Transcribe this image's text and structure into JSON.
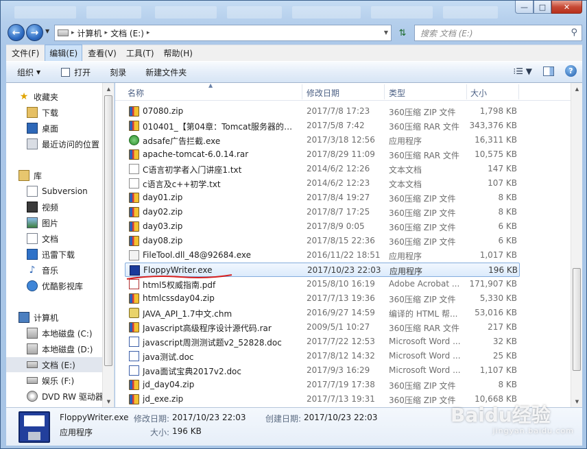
{
  "window": {
    "controls": {
      "minimize": "—",
      "maximize": "□",
      "close": "✕"
    }
  },
  "address": {
    "segments": [
      "计算机",
      "文档 (E:)"
    ],
    "search_placeholder": "搜索 文档 (E:)"
  },
  "menu": [
    "文件(F)",
    "编辑(E)",
    "查看(V)",
    "工具(T)",
    "帮助(H)"
  ],
  "toolbar": {
    "organize": "组织",
    "open": "打开",
    "burn": "刻录",
    "new_folder": "新建文件夹"
  },
  "navpane": {
    "favorites": {
      "title": "收藏夹",
      "items": [
        "下载",
        "桌面",
        "最近访问的位置"
      ]
    },
    "libraries": {
      "title": "库",
      "items": [
        "Subversion",
        "视频",
        "图片",
        "文档",
        "迅雷下载",
        "音乐",
        "优酷影视库"
      ]
    },
    "computer": {
      "title": "计算机",
      "items": [
        "本地磁盘 (C:)",
        "本地磁盘 (D:)",
        "文档 (E:)",
        "娱乐 (F:)",
        "DVD RW 驱动器"
      ]
    }
  },
  "columns": {
    "name": "名称",
    "date": "修改日期",
    "type": "类型",
    "size": "大小"
  },
  "files": [
    {
      "name": "07080.zip",
      "date": "2017/7/8 17:23",
      "type": "360压缩 ZIP 文件",
      "size": "1,798 KB",
      "icon": "zip"
    },
    {
      "name": "010401_【第04章：Tomcat服务器的安...",
      "date": "2017/5/8 7:42",
      "type": "360压缩 RAR 文件",
      "size": "343,376 KB",
      "icon": "zip"
    },
    {
      "name": "adsafe广告拦截.exe",
      "date": "2017/3/18 12:56",
      "type": "应用程序",
      "size": "16,311 KB",
      "icon": "green"
    },
    {
      "name": "apache-tomcat-6.0.14.rar",
      "date": "2017/8/29 11:09",
      "type": "360压缩 RAR 文件",
      "size": "10,575 KB",
      "icon": "zip"
    },
    {
      "name": "C语言初学者入门讲座1.txt",
      "date": "2014/6/2 12:26",
      "type": "文本文档",
      "size": "147 KB",
      "icon": "txt"
    },
    {
      "name": "c语言及c++初学.txt",
      "date": "2014/6/2 12:23",
      "type": "文本文档",
      "size": "107 KB",
      "icon": "txt"
    },
    {
      "name": "day01.zip",
      "date": "2017/8/4 19:27",
      "type": "360压缩 ZIP 文件",
      "size": "8 KB",
      "icon": "zip"
    },
    {
      "name": "day02.zip",
      "date": "2017/8/7 17:25",
      "type": "360压缩 ZIP 文件",
      "size": "8 KB",
      "icon": "zip"
    },
    {
      "name": "day03.zip",
      "date": "2017/8/9 0:05",
      "type": "360压缩 ZIP 文件",
      "size": "6 KB",
      "icon": "zip"
    },
    {
      "name": "day08.zip",
      "date": "2017/8/15 22:36",
      "type": "360压缩 ZIP 文件",
      "size": "6 KB",
      "icon": "zip"
    },
    {
      "name": "FileTool.dll_48@92684.exe",
      "date": "2016/11/22 18:51",
      "type": "应用程序",
      "size": "1,017 KB",
      "icon": "dll"
    },
    {
      "name": "FloppyWriter.exe",
      "date": "2017/10/23 22:03",
      "type": "应用程序",
      "size": "196 KB",
      "icon": "floppy",
      "selected": true
    },
    {
      "name": "html5权威指南.pdf",
      "date": "2015/8/10 16:19",
      "type": "Adobe Acrobat ...",
      "size": "171,907 KB",
      "icon": "pdf"
    },
    {
      "name": "htmlcssday04.zip",
      "date": "2017/7/13 19:36",
      "type": "360压缩 ZIP 文件",
      "size": "5,330 KB",
      "icon": "zip"
    },
    {
      "name": "JAVA_API_1.7中文.chm",
      "date": "2016/9/27 14:59",
      "type": "编译的 HTML 帮...",
      "size": "53,016 KB",
      "icon": "chm"
    },
    {
      "name": "Javascript高级程序设计源代码.rar",
      "date": "2009/5/1 10:27",
      "type": "360压缩 RAR 文件",
      "size": "217 KB",
      "icon": "zip"
    },
    {
      "name": "javascript周测测试题v2_52828.doc",
      "date": "2017/7/22 12:53",
      "type": "Microsoft Word ...",
      "size": "32 KB",
      "icon": "doc"
    },
    {
      "name": "java测试.doc",
      "date": "2017/8/12 14:32",
      "type": "Microsoft Word ...",
      "size": "25 KB",
      "icon": "doc"
    },
    {
      "name": "Java面试宝典2017v2.doc",
      "date": "2017/9/3 16:29",
      "type": "Microsoft Word ...",
      "size": "1,107 KB",
      "icon": "doc"
    },
    {
      "name": "jd_day04.zip",
      "date": "2017/7/19 17:38",
      "type": "360压缩 ZIP 文件",
      "size": "8 KB",
      "icon": "zip"
    },
    {
      "name": "jd_exe.zip",
      "date": "2017/7/13 19:31",
      "type": "360压缩 ZIP 文件",
      "size": "10,668 KB",
      "icon": "zip"
    }
  ],
  "details": {
    "name": "FloppyWriter.exe",
    "type": "应用程序",
    "modified_label": "修改日期:",
    "modified": "2017/10/23 22:03",
    "created_label": "创建日期:",
    "created": "2017/10/23 22:03",
    "size_label": "大小:",
    "size": "196 KB"
  },
  "watermark": {
    "text": "Baidu经验",
    "sub": "jingyan.baidu.com"
  },
  "colors": {
    "selection": "#dcebfc",
    "selection_border": "#84acdd",
    "annotation": "#d62020"
  }
}
